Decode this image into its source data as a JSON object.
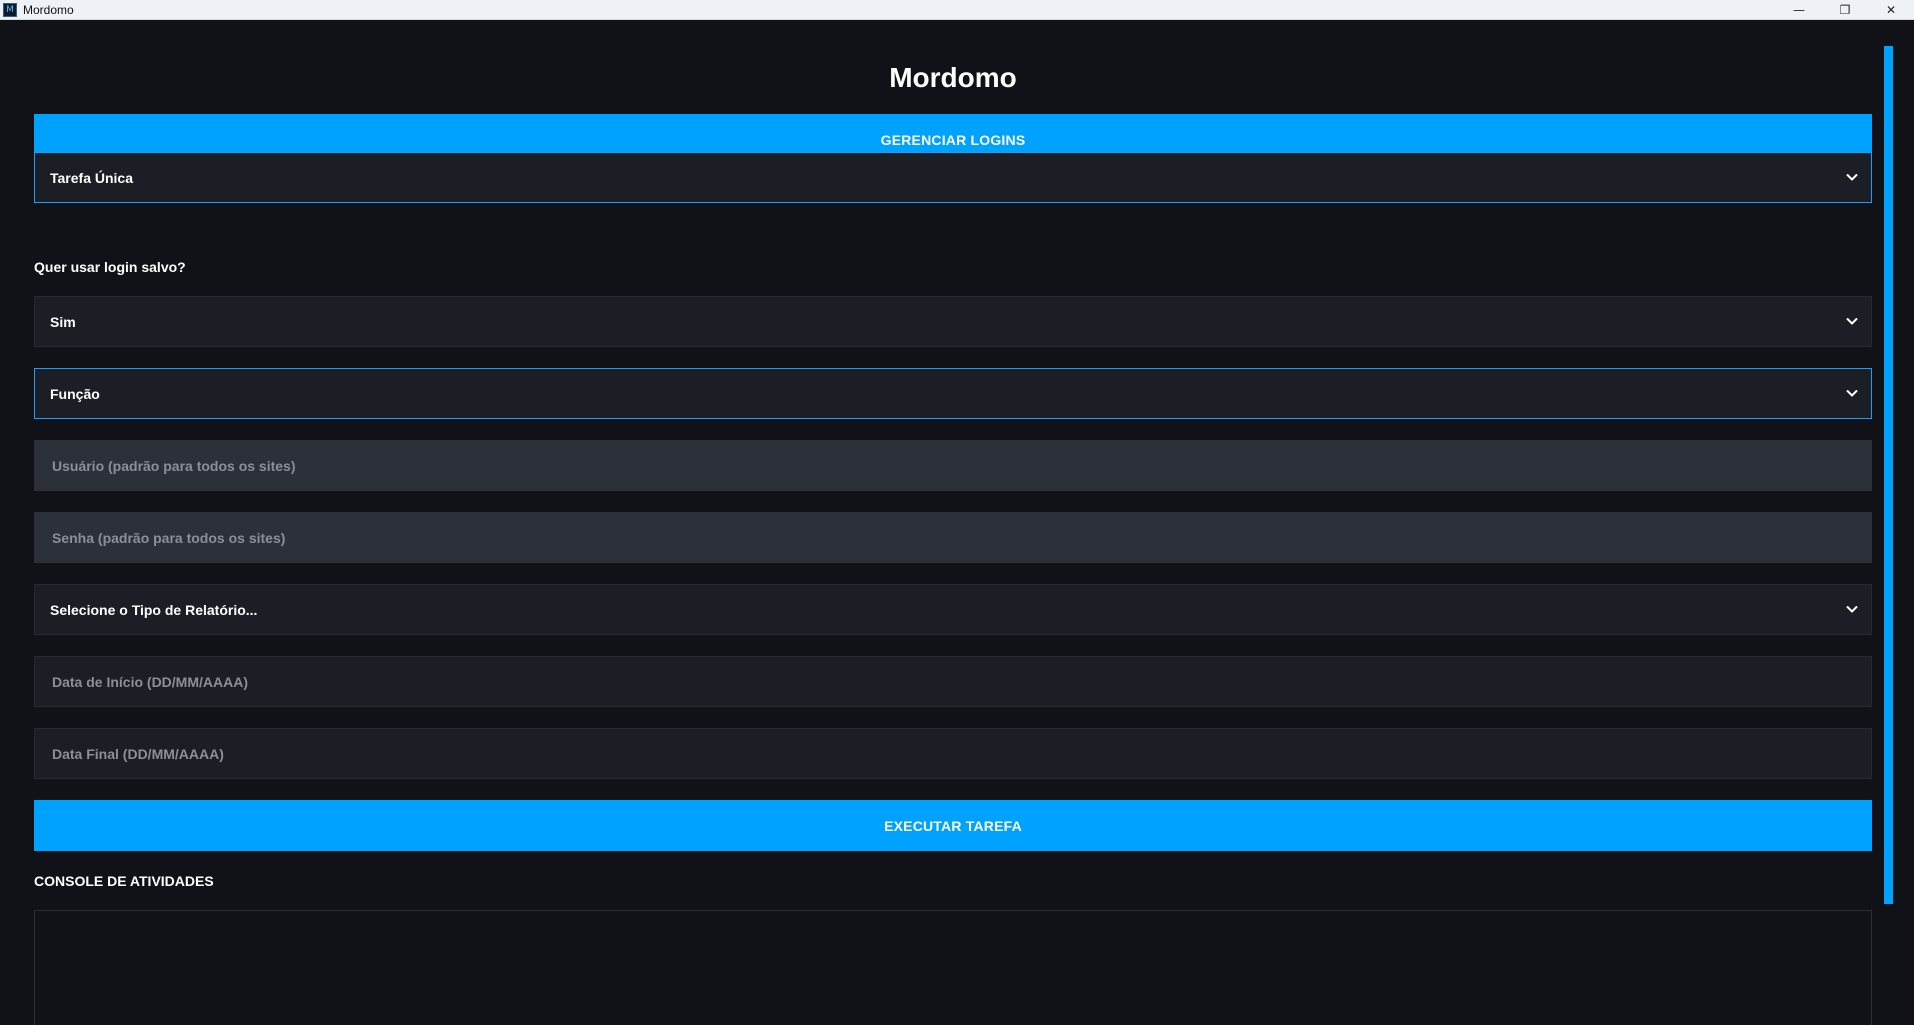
{
  "window": {
    "title": "Mordomo",
    "icon_text": "M",
    "minimize_glyph": "—",
    "maximize_glyph": "❐",
    "close_glyph": "✕"
  },
  "app": {
    "heading": "Mordomo",
    "manage_logins_label": "GERENCIAR LOGINS",
    "task_mode": {
      "selected": "Tarefa Única"
    },
    "saved_login_question": "Quer usar login salvo?",
    "saved_login": {
      "selected": "Sim"
    },
    "function": {
      "selected": "Função"
    },
    "user_field": {
      "placeholder": "Usuário (padrão para todos os sites)",
      "value": ""
    },
    "password_field": {
      "placeholder": "Senha (padrão para todos os sites)",
      "value": ""
    },
    "report_type": {
      "selected": "Selecione o Tipo de Relatório..."
    },
    "start_date": {
      "placeholder": "Data de Início (DD/MM/AAAA)",
      "value": ""
    },
    "end_date": {
      "placeholder": "Data Final (DD/MM/AAAA)",
      "value": ""
    },
    "execute_label": "EXECUTAR TAREFA",
    "console_label": "CONSOLE DE ATIVIDADES",
    "console_content": ""
  },
  "colors": {
    "accent": "#00a2ff",
    "background": "#101217",
    "field_dark": "#1b1e25",
    "field_light": "#2c3039",
    "focus_border": "#1e9bff"
  },
  "icons": {
    "dropdown": "chevron-down-icon"
  }
}
